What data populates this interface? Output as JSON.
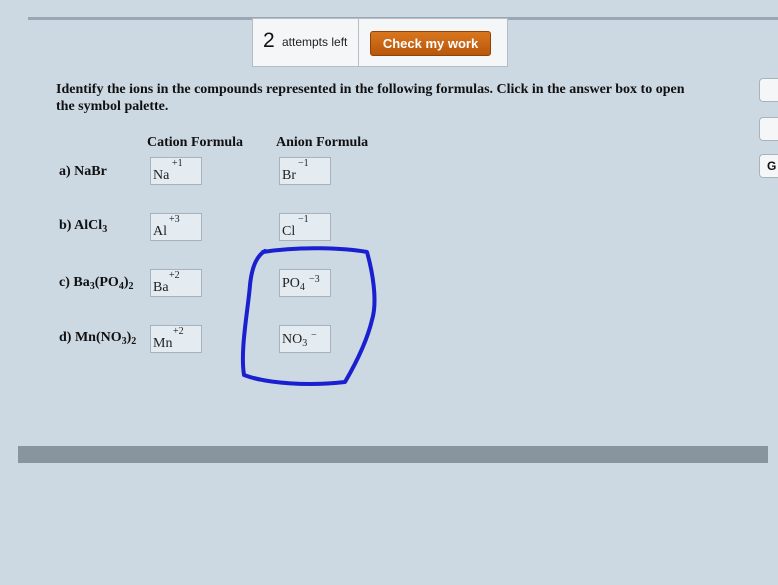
{
  "header": {
    "attempts_count": "2",
    "attempts_label": "attempts left",
    "check_button_label": "Check my work"
  },
  "instructions": "Identify the ions in the compounds represented in the following formulas. Click in the answer box to open the symbol palette.",
  "columns": {
    "cation": "Cation Formula",
    "anion": "Anion Formula"
  },
  "rows": [
    {
      "label_parts": [
        "a) NaBr",
        "",
        ""
      ],
      "cation": {
        "symbol": "Na",
        "sub": "",
        "charge": "+1"
      },
      "anion": {
        "symbol": "Br",
        "sub": "",
        "charge": "−1"
      }
    },
    {
      "label_parts": [
        "b) AlCl",
        "3",
        ""
      ],
      "cation": {
        "symbol": "Al",
        "sub": "",
        "charge": "+3"
      },
      "anion": {
        "symbol": "Cl",
        "sub": "",
        "charge": "−1"
      }
    },
    {
      "label_parts": [
        "c) Ba",
        "3",
        "(PO",
        "4",
        ")",
        "2"
      ],
      "cation": {
        "symbol": "Ba",
        "sub": "",
        "charge": "+2"
      },
      "anion": {
        "symbol": "PO",
        "sub": "4",
        "charge": "−3"
      }
    },
    {
      "label_parts": [
        "d) Mn(NO",
        "3",
        ")",
        "2"
      ],
      "cation": {
        "symbol": "Mn",
        "sub": "",
        "charge": "+2"
      },
      "anion": {
        "symbol": "NO",
        "sub": "3",
        "charge": "−"
      }
    }
  ],
  "side_buttons": [
    "",
    "",
    "G"
  ],
  "colors": {
    "accent_button": "#c8661a",
    "annotation": "#1a1fcf",
    "background": "#ccd8e2"
  },
  "annotation": {
    "type": "hand-drawn-loop",
    "color": "#1a1fcf"
  }
}
